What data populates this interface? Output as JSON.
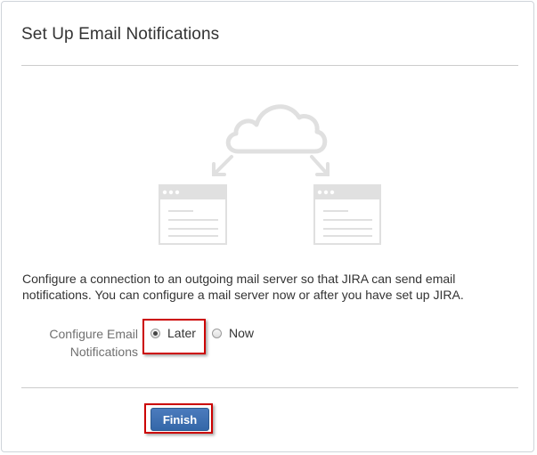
{
  "header": {
    "title": "Set Up Email Notifications"
  },
  "illustration": {
    "icons": [
      "cloud-icon",
      "arrow-down-left-icon",
      "arrow-down-right-icon",
      "browser-window-icon",
      "browser-window-icon"
    ]
  },
  "body": {
    "description": "Configure a connection to an outgoing mail server so that JIRA can send email notifications. You can configure a mail server now or after you have set up JIRA."
  },
  "form": {
    "label": "Configure Email Notifications",
    "options": [
      {
        "label": "Later",
        "checked": true
      },
      {
        "label": "Now",
        "checked": false
      }
    ]
  },
  "actions": {
    "finish_label": "Finish"
  },
  "colors": {
    "highlight": "#cc0000",
    "primary_button": "#3b6fb0",
    "illustration": "#e0e0e0"
  }
}
